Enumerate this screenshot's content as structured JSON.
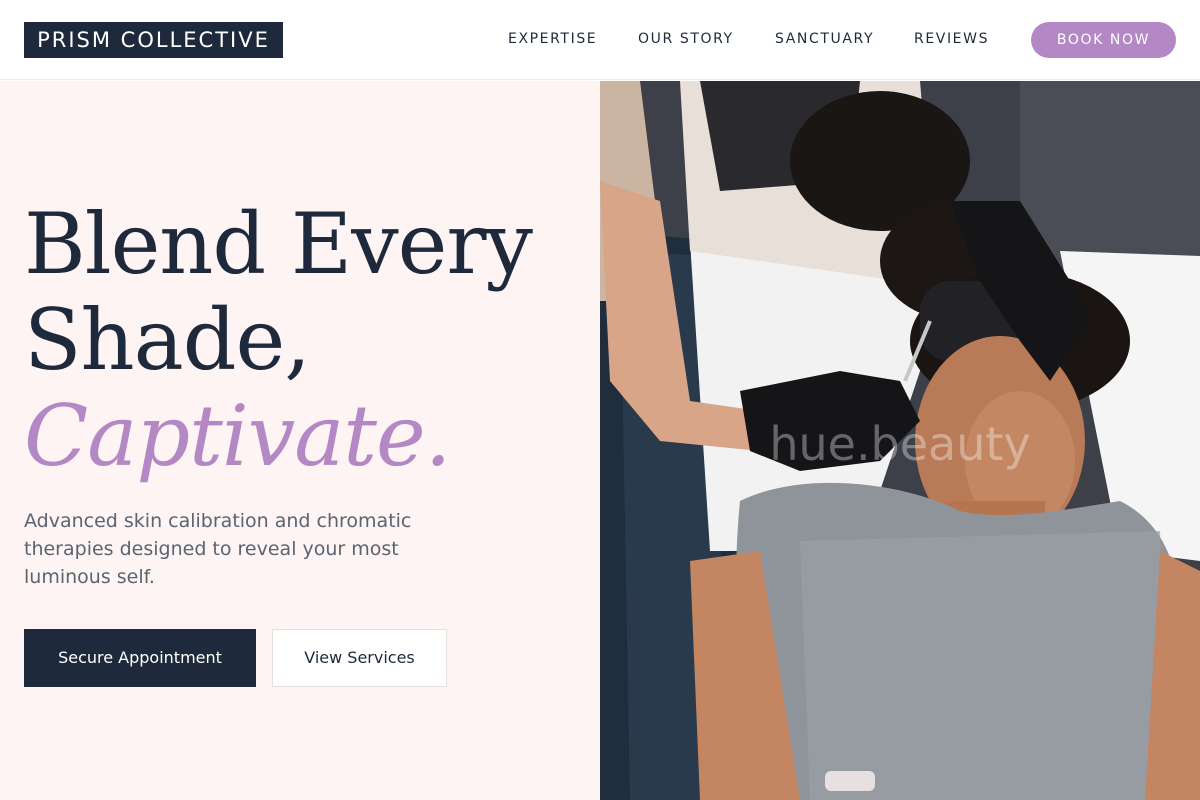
{
  "brand": {
    "name": "PRISM COLLECTIVE"
  },
  "nav": {
    "items": [
      {
        "label": "EXPERTISE"
      },
      {
        "label": "OUR STORY"
      },
      {
        "label": "SANCTUARY"
      },
      {
        "label": "REVIEWS"
      }
    ],
    "cta_label": "BOOK NOW"
  },
  "hero": {
    "headline_line1": "Blend Every",
    "headline_line2": "Shade,",
    "headline_line3": "Captivate.",
    "subtext": "Advanced skin calibration and chromatic therapies designed to reveal your most luminous self.",
    "primary_cta": "Secure Appointment",
    "secondary_cta": "View Services"
  },
  "photo": {
    "watermark": "hue.beauty"
  },
  "colors": {
    "navy": "#1e2a3b",
    "accent": "#b388c4",
    "hero_bg": "#fdf4f3"
  }
}
